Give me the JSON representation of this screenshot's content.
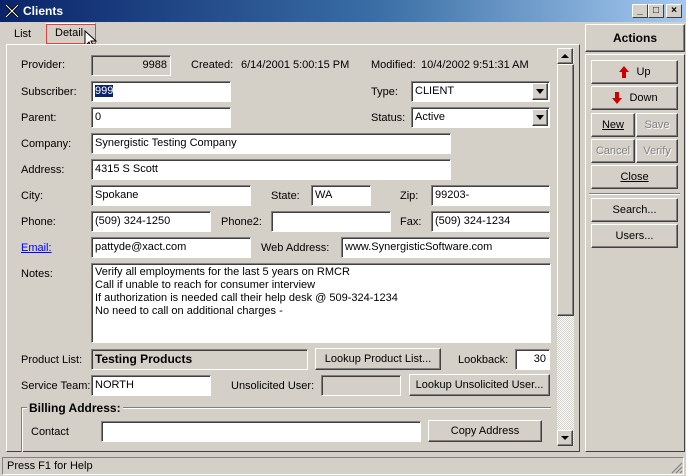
{
  "window": {
    "title": "Clients",
    "minimize_glyph": "_",
    "maximize_glyph": "□",
    "close_glyph": "×"
  },
  "tabs": [
    {
      "label": "List"
    },
    {
      "label": "Detail"
    }
  ],
  "form": {
    "provider_label": "Provider:",
    "provider_value": "9988",
    "created_label": "Created:",
    "created_value": "6/14/2001 5:00:15 PM",
    "modified_label": "Modified:",
    "modified_value": "10/4/2002 9:51:31 AM",
    "subscriber_label": "Subscriber:",
    "subscriber_value": "999",
    "type_label": "Type:",
    "type_value": "CLIENT",
    "parent_label": "Parent:",
    "parent_value": "0",
    "status_label": "Status:",
    "status_value": "Active",
    "company_label": "Company:",
    "company_value": "Synergistic Testing Company",
    "address_label": "Address:",
    "address_value": "4315 S Scott",
    "city_label": "City:",
    "city_value": "Spokane",
    "state_label": "State:",
    "state_value": "WA",
    "zip_label": "Zip:",
    "zip_value": "99203-",
    "phone_label": "Phone:",
    "phone_value": "(509) 324-1250",
    "phone2_label": "Phone2:",
    "phone2_value": "",
    "fax_label": "Fax:",
    "fax_value": "(509) 324-1234",
    "email_label": "Email:",
    "email_value": "pattyde@xact.com",
    "web_label": "Web Address:",
    "web_value": "www.SynergisticSoftware.com",
    "notes_label": "Notes:",
    "notes_lines": [
      "Verify all employments for the last 5 years on RMCR",
      "Call if unable to reach for consumer interview",
      "If authorization is needed call their help desk @ 509-324-1234",
      "No need to call on additional charges -"
    ],
    "product_list_label": "Product List:",
    "product_list_value": "Testing Products",
    "lookup_product_label": "Lookup Product List...",
    "lookback_label": "Lookback:",
    "lookback_value": "30",
    "service_team_label": "Service Team:",
    "service_team_value": "NORTH",
    "unsolicited_user_label": "Unsolicited User:",
    "unsolicited_user_value": "",
    "lookup_unsolicited_label": "Lookup Unsolicited User...",
    "billing_address_label": "Billing Address:",
    "contact_label": "Contact",
    "contact_value": "",
    "copy_address_label": "Copy Address"
  },
  "actions": {
    "header": "Actions",
    "up_label": "Up",
    "down_label": "Down",
    "new_label": "New",
    "save_label": "Save",
    "cancel_label": "Cancel",
    "verify_label": "Verify",
    "close_label": "Close",
    "search_label": "Search...",
    "users_label": "Users..."
  },
  "status_bar": {
    "text": "Press F1 for Help"
  },
  "colors": {
    "titlebar_start": "#0a246a",
    "face": "#d4d0c8",
    "selection": "#0a246a",
    "link": "#0000ff",
    "arrow_red": "#cc0000",
    "tab_highlight": "#e04040"
  }
}
